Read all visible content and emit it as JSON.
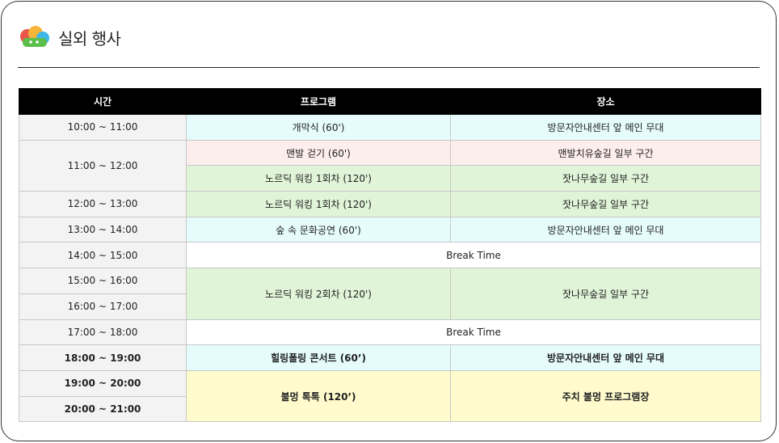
{
  "page": {
    "title": "실외 행사"
  },
  "icon": {
    "name": "cloud-logo-icon",
    "colors": [
      "#e8574a",
      "#f5b53a",
      "#5bbf4a",
      "#3eb6e6"
    ]
  },
  "table": {
    "headers": {
      "time": "시간",
      "program": "프로그램",
      "place": "장소"
    },
    "rows": [
      {
        "time": "10:00 ~ 11:00",
        "program": "개막식 (60')",
        "place": "방문자안내센터 앞 메인 무대"
      },
      {
        "time": "11:00 ~ 12:00",
        "program": "맨발 걷기 (60')",
        "place": "맨발치유숲길 일부 구간"
      },
      {
        "program": "노르딕 워킹 1회차 (120')",
        "place": "잣나무숲길 일부 구간"
      },
      {
        "time": "12:00 ~ 13:00",
        "program": "노르딕 워킹 1회차 (120')",
        "place": "잣나무숲길 일부 구간"
      },
      {
        "time": "13:00 ~ 14:00",
        "program": "숲 속 문화공연 (60')",
        "place": "방문자안내센터 앞 메인 무대"
      },
      {
        "time": "14:00 ~ 15:00",
        "break": "Break Time"
      },
      {
        "time": "15:00 ~ 16:00",
        "program": "노르딕 워킹 2회차 (120')",
        "place": "잣나무숲길 일부 구간"
      },
      {
        "time": "16:00 ~ 17:00"
      },
      {
        "time": "17:00 ~ 18:00",
        "break": "Break Time"
      },
      {
        "time": "18:00 ~ 19:00",
        "program": "힐링폴링 콘서트 (60’)",
        "place": "방문자안내센터 앞 메인 무대"
      },
      {
        "time": "19:00 ~ 20:00",
        "program": "불멍 톡톡 (120’)",
        "place": "주치 불멍 프로그램장"
      },
      {
        "time": "20:00 ~ 21:00"
      }
    ]
  }
}
